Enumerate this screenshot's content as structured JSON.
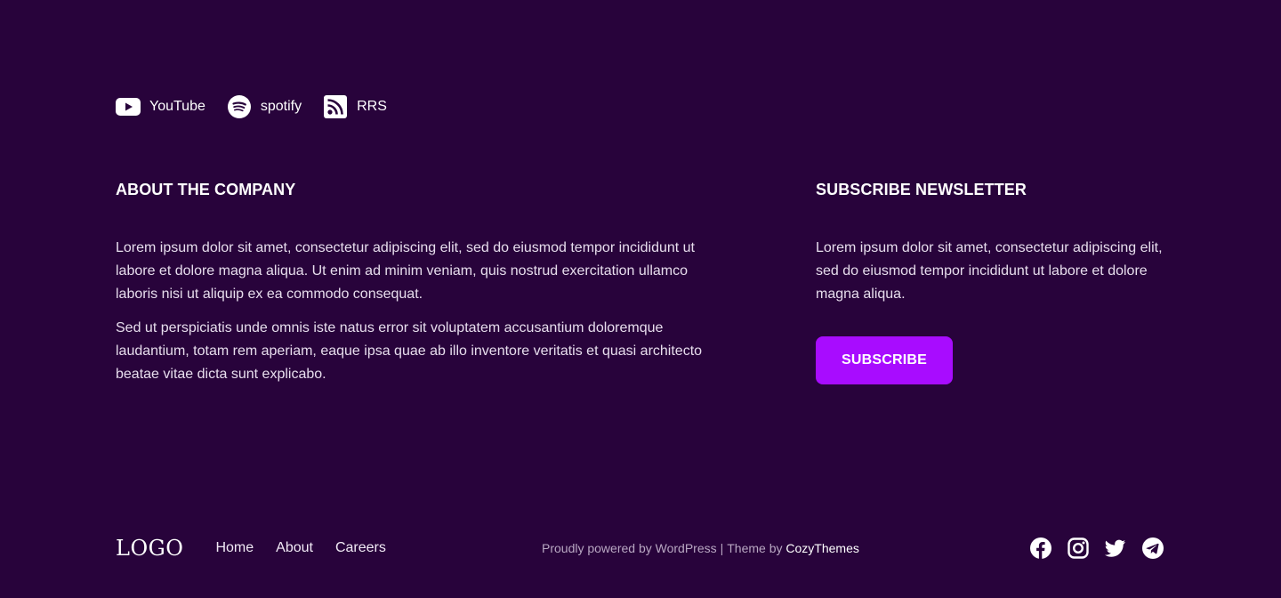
{
  "social_links": [
    {
      "label": "YouTube",
      "icon": "youtube-icon"
    },
    {
      "label": "spotify",
      "icon": "spotify-icon"
    },
    {
      "label": "RRS",
      "icon": "rss-icon"
    }
  ],
  "about": {
    "heading": "ABOUT THE COMPANY",
    "paragraph_1": "Lorem ipsum dolor sit amet, consectetur adipiscing elit, sed do eiusmod tempor incididunt ut labore et dolore magna aliqua. Ut enim ad minim veniam, quis nostrud exercitation ullamco laboris nisi ut aliquip ex ea commodo consequat.",
    "paragraph_2": "Sed ut perspiciatis unde omnis iste natus error sit voluptatem accusantium doloremque laudantium, totam rem aperiam, eaque ipsa quae ab illo inventore veritatis et quasi architecto beatae vitae dicta sunt explicabo."
  },
  "newsletter": {
    "heading": "SUBSCRIBE NEWSLETTER",
    "text": "Lorem ipsum dolor sit amet, consectetur adipiscing elit, sed do eiusmod tempor incididunt ut labore et dolore magna aliqua.",
    "button_label": "SUBSCRIBE"
  },
  "footer": {
    "logo": "LOGO",
    "nav": [
      "Home",
      "About",
      "Careers"
    ],
    "credits": {
      "powered": "Proudly powered by WordPress",
      "separator": "|",
      "theme_prefix": "Theme by",
      "theme_author": "CozyThemes"
    },
    "social_icons": [
      "facebook-icon",
      "instagram-icon",
      "twitter-icon",
      "telegram-icon"
    ]
  },
  "colors": {
    "background": "#28033b",
    "accent": "#a80cff",
    "text": "#ffffff",
    "muted_text": "#b8a7c2"
  }
}
